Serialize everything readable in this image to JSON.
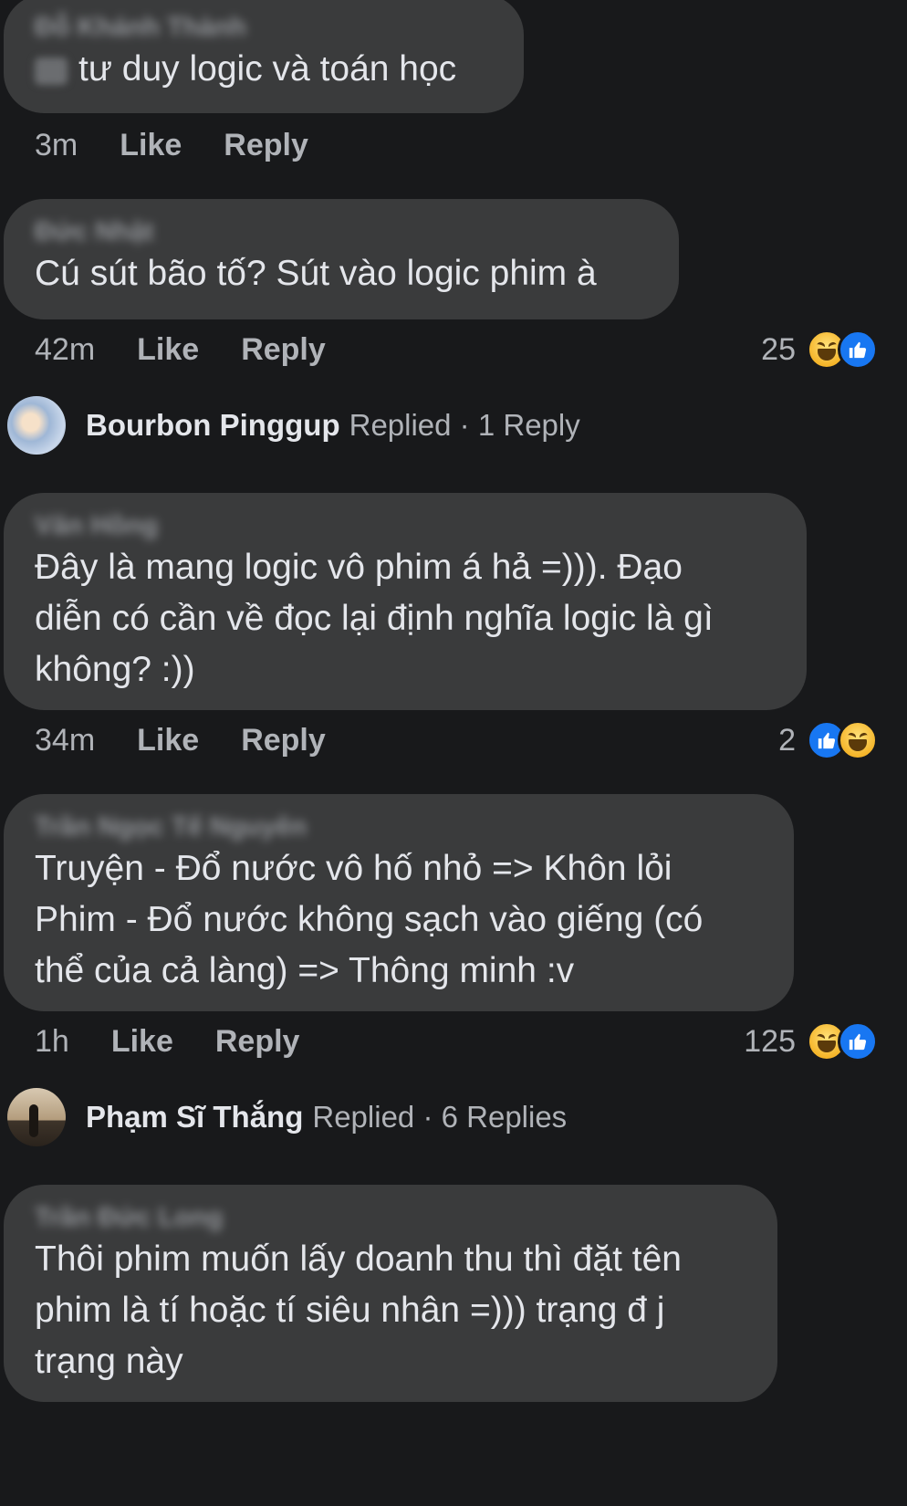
{
  "comments": [
    {
      "author": "Đỗ Khánh Thành",
      "text": "tư duy logic và toán học",
      "time": "3m",
      "like_label": "Like",
      "reply_label": "Reply"
    },
    {
      "author": "Đức Nhật",
      "text": "Cú sút bão tố? Sút vào logic phim à",
      "time": "42m",
      "like_label": "Like",
      "reply_label": "Reply",
      "reaction_count": "25",
      "reactions": [
        "haha-icon",
        "like-icon"
      ]
    },
    {
      "author": "Văn Hồng",
      "text": "Đây là mang logic vô phim á hả =))). Đạo\ndiễn có cần về đọc lại định nghĩa logic là gì\nkhông? :))",
      "time": "34m",
      "like_label": "Like",
      "reply_label": "Reply",
      "reaction_count": "2",
      "reactions": [
        "like-icon",
        "haha-icon"
      ]
    },
    {
      "author": "Trần Ngọc Tế Nguyên",
      "text": "Truyện - Đổ nước vô hố nhỏ => Khôn lỏi\nPhim - Đổ nước không sạch vào giếng (có\nthể của cả làng) => Thông minh :v",
      "time": "1h",
      "like_label": "Like",
      "reply_label": "Reply",
      "reaction_count": "125",
      "reactions": [
        "haha-icon",
        "like-icon"
      ]
    },
    {
      "author": "Trần Đức Long",
      "text": "Thôi phim muốn lấy doanh thu thì đặt tên\nphim là tí hoặc tí siêu nhân =))) trạng đ j\ntrạng này"
    }
  ],
  "replies": [
    {
      "name": "Bourbon Pinggup",
      "status": "Replied · 1 Reply"
    },
    {
      "name": "Phạm Sĩ Thắng",
      "status": "Replied · 6 Replies"
    }
  ],
  "colors": {
    "background": "#18191b",
    "bubble": "#3a3b3c",
    "primary_text": "#e4e6eb",
    "secondary_text": "#b0b3b8",
    "like_blue": "#1877f2",
    "haha_yellow": "#f5b52a"
  }
}
